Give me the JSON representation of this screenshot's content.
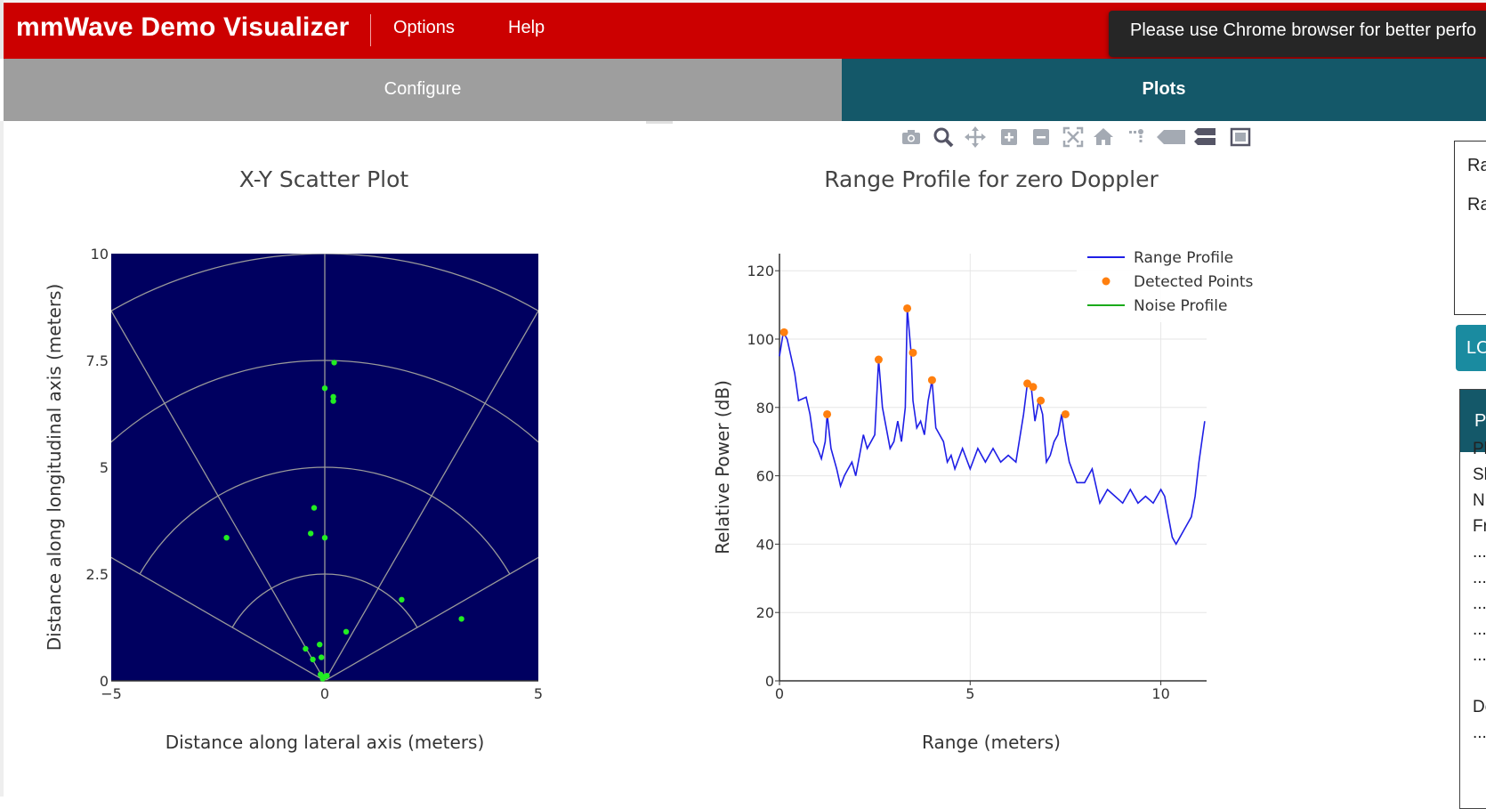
{
  "app": {
    "title": "mmWave Demo Visualizer",
    "menu": [
      "Options",
      "Help"
    ],
    "toast": "Please use Chrome browser for better perfo",
    "colors": {
      "appbar": "#cc0000",
      "active_tab": "#145869",
      "inactive_tab": "#9e9e9e",
      "button": "#1a8ba0"
    }
  },
  "tabs": [
    {
      "label": "Configure",
      "active": false
    },
    {
      "label": "Plots",
      "active": true
    }
  ],
  "modebar": [
    "camera-icon",
    "zoom-icon",
    "pan-icon",
    "zoom-in-icon",
    "zoom-out-icon",
    "autoscale-icon",
    "reset-axes-icon",
    "spike-lines-icon",
    "hover-closest-icon",
    "hover-compare-icon",
    "fullscreen-icon"
  ],
  "right_panel": {
    "box_lines": [
      "Ra",
      "Ra"
    ],
    "button_label": "LO",
    "stats_header": "P",
    "stats_lines": [
      "Pl",
      "Sl",
      "N",
      "Fr",
      "...",
      "...",
      "...",
      "...",
      "...",
      "",
      "De",
      "..."
    ]
  },
  "chart_data": [
    {
      "type": "scatter",
      "title": "X-Y Scatter Plot",
      "xlabel": "Distance along lateral axis (meters)",
      "ylabel": "Distance along longitudinal axis (meters)",
      "xlim": [
        -5,
        5
      ],
      "ylim": [
        0,
        10
      ],
      "xticks": [
        -5,
        0,
        5
      ],
      "xtick_labels": [
        "−5",
        "0",
        "5"
      ],
      "yticks": [
        0,
        2.5,
        5,
        7.5,
        10
      ],
      "ytick_labels": [
        "0",
        "2.5",
        "5",
        "7.5",
        "10"
      ],
      "background": "#000060",
      "point_color": "#22ee22",
      "grid": "polar range rings at 2.5 m steps and angle spokes every 30 degrees",
      "points": [
        {
          "x": 0.22,
          "y": 7.45
        },
        {
          "x": 0.0,
          "y": 6.85
        },
        {
          "x": 0.2,
          "y": 6.65
        },
        {
          "x": 0.2,
          "y": 6.55
        },
        {
          "x": -0.25,
          "y": 4.05
        },
        {
          "x": -2.3,
          "y": 3.35
        },
        {
          "x": -0.33,
          "y": 3.45
        },
        {
          "x": 0.0,
          "y": 3.35
        },
        {
          "x": 1.8,
          "y": 1.9
        },
        {
          "x": 3.2,
          "y": 1.45
        },
        {
          "x": 0.5,
          "y": 1.15
        },
        {
          "x": -0.45,
          "y": 0.75
        },
        {
          "x": -0.12,
          "y": 0.85
        },
        {
          "x": -0.28,
          "y": 0.5
        },
        {
          "x": -0.08,
          "y": 0.55
        },
        {
          "x": -0.1,
          "y": 0.15
        },
        {
          "x": 0.0,
          "y": 0.1
        },
        {
          "x": -0.05,
          "y": 0.05
        },
        {
          "x": 0.05,
          "y": 0.12
        }
      ]
    },
    {
      "type": "line",
      "title": "Range Profile for zero Doppler",
      "xlabel": "Range (meters)",
      "ylabel": "Relative Power (dB)",
      "xlim": [
        0,
        11.2
      ],
      "ylim": [
        0,
        125
      ],
      "xticks": [
        0,
        5,
        10
      ],
      "yticks": [
        0,
        20,
        40,
        60,
        80,
        100,
        120
      ],
      "grid": true,
      "legend_position": "top-right",
      "legend": [
        "Range Profile",
        "Detected Points",
        "Noise Profile"
      ],
      "series": [
        {
          "name": "Range Profile",
          "color": "#1f1fe6",
          "x": [
            0,
            0.1,
            0.2,
            0.4,
            0.5,
            0.7,
            0.8,
            0.9,
            1.0,
            1.1,
            1.2,
            1.25,
            1.35,
            1.5,
            1.6,
            1.7,
            1.8,
            1.9,
            2.0,
            2.1,
            2.2,
            2.3,
            2.4,
            2.5,
            2.6,
            2.7,
            2.8,
            2.9,
            3.0,
            3.1,
            3.2,
            3.3,
            3.35,
            3.45,
            3.5,
            3.6,
            3.7,
            3.8,
            3.9,
            4.0,
            4.1,
            4.2,
            4.3,
            4.4,
            4.5,
            4.6,
            4.8,
            5.0,
            5.2,
            5.4,
            5.6,
            5.8,
            6.0,
            6.2,
            6.4,
            6.5,
            6.6,
            6.7,
            6.8,
            6.9,
            7.0,
            7.1,
            7.2,
            7.3,
            7.4,
            7.5,
            7.6,
            7.8,
            8.0,
            8.2,
            8.4,
            8.6,
            8.8,
            9.0,
            9.2,
            9.4,
            9.6,
            9.8,
            10.0,
            10.1,
            10.2,
            10.3,
            10.4,
            10.5,
            10.6,
            10.7,
            10.8,
            10.9,
            11.0,
            11.1,
            11.15
          ],
          "y": [
            95,
            102,
            100,
            90,
            82,
            83,
            78,
            70,
            68,
            65,
            70,
            78,
            68,
            62,
            57,
            60,
            62,
            64,
            60,
            66,
            72,
            68,
            70,
            72,
            94,
            80,
            74,
            68,
            70,
            76,
            70,
            80,
            109,
            96,
            82,
            74,
            76,
            72,
            82,
            88,
            74,
            72,
            70,
            64,
            66,
            62,
            68,
            62,
            68,
            64,
            68,
            64,
            66,
            64,
            78,
            87,
            86,
            76,
            82,
            78,
            64,
            66,
            70,
            72,
            78,
            70,
            64,
            58,
            58,
            62,
            52,
            56,
            54,
            52,
            56,
            52,
            54,
            52,
            56,
            54,
            48,
            42,
            40,
            42,
            44,
            46,
            48,
            54,
            64,
            72,
            76
          ]
        },
        {
          "name": "Detected Points",
          "color": "#ff7f0e",
          "x": [
            0.12,
            1.25,
            2.6,
            3.35,
            3.5,
            4.0,
            6.5,
            6.65,
            6.85,
            7.5
          ],
          "y": [
            102,
            78,
            94,
            109,
            96,
            88,
            87,
            86,
            82,
            78
          ]
        },
        {
          "name": "Noise Profile",
          "color": "#1aaa1a",
          "x": [],
          "y": []
        }
      ]
    }
  ]
}
